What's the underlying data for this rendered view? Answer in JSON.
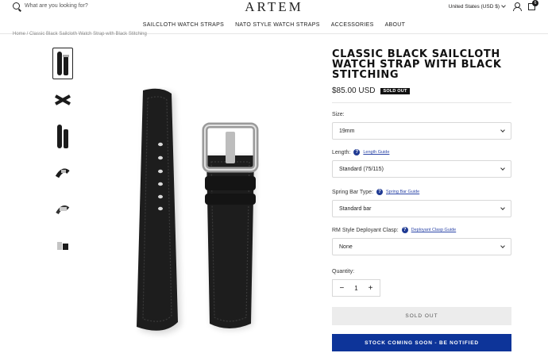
{
  "header": {
    "search_placeholder": "What are you looking for?",
    "logo": "ARTEM",
    "region": "United States (USD $)",
    "cart_count": "6"
  },
  "nav": {
    "items": [
      "SAILCLOTH WATCH STRAPS",
      "NATO STYLE WATCH STRAPS",
      "ACCESSORIES",
      "ABOUT"
    ]
  },
  "breadcrumb": "Home / Classic Black Sailcloth Watch Strap with Black Stitching",
  "product": {
    "title": "CLASSIC BLACK SAILCLOTH WATCH STRAP WITH BLACK STITCHING",
    "price": "$85.00 USD",
    "badge": "SOLD OUT"
  },
  "options": {
    "size": {
      "label": "Size:",
      "value": "19mm"
    },
    "length": {
      "label": "Length:",
      "guide": "Length Guide",
      "value": "Standard (75/115)"
    },
    "spring_bar": {
      "label": "Spring Bar Type:",
      "guide": "Spring Bar Guide",
      "value": "Standard bar"
    },
    "clasp": {
      "label": "RM Style Deployant Clasp:",
      "guide": "Deployant Clasp Guide",
      "value": "None"
    }
  },
  "quantity": {
    "label": "Quantity:",
    "value": "1",
    "minus": "−",
    "plus": "+"
  },
  "buttons": {
    "sold_out": "SOLD OUT",
    "notify": "STOCK COMING SOON - BE NOTIFIED"
  },
  "colors": {
    "accent": "#0d3499",
    "help_icon": "#1f3a93",
    "badge_bg": "#111111"
  },
  "icons": {
    "search": "search-icon",
    "account": "user-icon",
    "cart": "bag-icon",
    "help": "question-icon"
  }
}
